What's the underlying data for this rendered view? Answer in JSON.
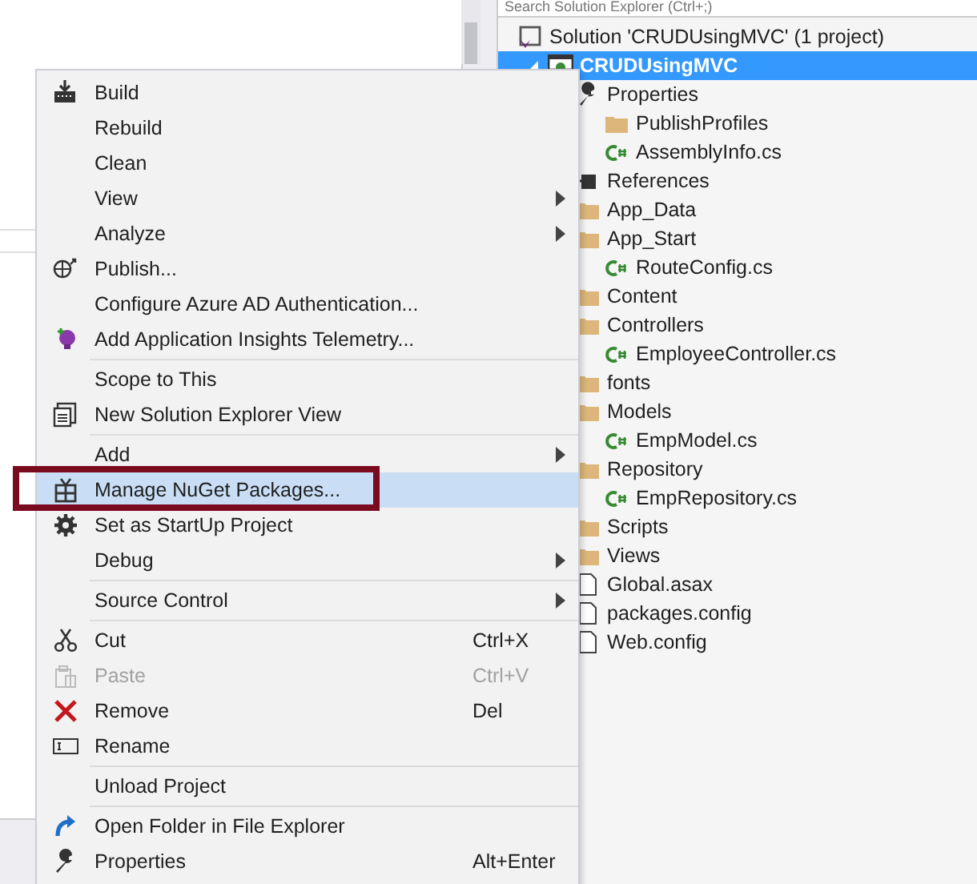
{
  "solution_explorer": {
    "search": {
      "placeholder": "Search Solution Explorer (Ctrl+;)"
    },
    "tree": [
      {
        "label": "Solution 'CRUDUsingMVC' (1 project)",
        "kind": "solution",
        "selected": false,
        "children": [
          {
            "label": "CRUDUsingMVC",
            "kind": "project",
            "selected": true,
            "expanded": true,
            "children": [
              {
                "label": "Properties",
                "kind": "properties",
                "selected": false,
                "children": [
                  {
                    "label": "PublishProfiles",
                    "kind": "folder",
                    "selected": false
                  },
                  {
                    "label": "AssemblyInfo.cs",
                    "kind": "csharp",
                    "selected": false
                  }
                ]
              },
              {
                "label": "References",
                "kind": "references",
                "selected": false
              },
              {
                "label": "App_Data",
                "kind": "folder",
                "selected": false
              },
              {
                "label": "App_Start",
                "kind": "folder",
                "selected": false,
                "children": [
                  {
                    "label": "RouteConfig.cs",
                    "kind": "csharp",
                    "selected": false
                  }
                ]
              },
              {
                "label": "Content",
                "kind": "folder",
                "selected": false
              },
              {
                "label": "Controllers",
                "kind": "folder",
                "selected": false,
                "children": [
                  {
                    "label": "EmployeeController.cs",
                    "kind": "csharp",
                    "selected": false
                  }
                ]
              },
              {
                "label": "fonts",
                "kind": "folder",
                "selected": false
              },
              {
                "label": "Models",
                "kind": "folder",
                "selected": false,
                "children": [
                  {
                    "label": "EmpModel.cs",
                    "kind": "csharp",
                    "selected": false
                  }
                ]
              },
              {
                "label": "Repository",
                "kind": "folder",
                "selected": false,
                "children": [
                  {
                    "label": "EmpRepository.cs",
                    "kind": "csharp",
                    "selected": false
                  }
                ]
              },
              {
                "label": "Scripts",
                "kind": "folder",
                "selected": false
              },
              {
                "label": "Views",
                "kind": "folder",
                "selected": false
              },
              {
                "label": "Global.asax",
                "kind": "file",
                "selected": false
              },
              {
                "label": "packages.config",
                "kind": "file",
                "selected": false
              },
              {
                "label": "Web.config",
                "kind": "file",
                "selected": false
              }
            ]
          }
        ]
      }
    ]
  },
  "context_menu": {
    "items": [
      {
        "kind": "item",
        "label": "Build",
        "disabled": false,
        "selected": false
      },
      {
        "kind": "item",
        "label": "Rebuild",
        "disabled": false,
        "selected": false
      },
      {
        "kind": "item",
        "label": "Clean",
        "disabled": false,
        "selected": false
      },
      {
        "kind": "submenu",
        "label": "View",
        "disabled": false,
        "selected": false
      },
      {
        "kind": "submenu",
        "label": "Analyze",
        "disabled": false,
        "selected": false
      },
      {
        "kind": "item",
        "label": "Publish...",
        "disabled": false,
        "selected": false
      },
      {
        "kind": "item",
        "label": "Configure Azure AD Authentication...",
        "disabled": false,
        "selected": false
      },
      {
        "kind": "item",
        "label": "Add Application Insights Telemetry...",
        "disabled": false,
        "selected": false
      },
      {
        "kind": "separator"
      },
      {
        "kind": "item",
        "label": "Scope to This",
        "disabled": false,
        "selected": false
      },
      {
        "kind": "item",
        "label": "New Solution Explorer View",
        "disabled": false,
        "selected": false
      },
      {
        "kind": "separator"
      },
      {
        "kind": "submenu",
        "label": "Add",
        "disabled": false,
        "selected": false
      },
      {
        "kind": "item",
        "label": "Manage NuGet Packages...",
        "disabled": false,
        "selected": true,
        "annotated": true
      },
      {
        "kind": "item",
        "label": "Set as StartUp Project",
        "disabled": false,
        "selected": false
      },
      {
        "kind": "submenu",
        "label": "Debug",
        "disabled": false,
        "selected": false
      },
      {
        "kind": "separator"
      },
      {
        "kind": "submenu",
        "label": "Source Control",
        "disabled": false,
        "selected": false
      },
      {
        "kind": "separator"
      },
      {
        "kind": "item",
        "label": "Cut",
        "shortcut": "Ctrl+X",
        "disabled": false,
        "selected": false
      },
      {
        "kind": "item",
        "label": "Paste",
        "shortcut": "Ctrl+V",
        "disabled": true,
        "selected": false
      },
      {
        "kind": "item",
        "label": "Remove",
        "shortcut": "Del",
        "disabled": false,
        "selected": false
      },
      {
        "kind": "item",
        "label": "Rename",
        "disabled": false,
        "selected": false
      },
      {
        "kind": "separator"
      },
      {
        "kind": "item",
        "label": "Unload Project",
        "disabled": false,
        "selected": false
      },
      {
        "kind": "separator"
      },
      {
        "kind": "item",
        "label": "Open Folder in File Explorer",
        "disabled": false,
        "selected": false
      },
      {
        "kind": "item",
        "label": "Properties",
        "shortcut": "Alt+Enter",
        "disabled": false,
        "selected": false
      }
    ]
  }
}
